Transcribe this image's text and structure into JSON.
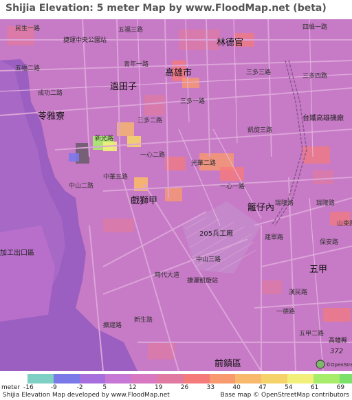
{
  "title": "Shijia Elevation: 5 meter Map by www.FloodMap.net (beta)",
  "map": {
    "places": [
      {
        "id": "lindeguan",
        "name": "林德官"
      },
      {
        "id": "kaohsiung",
        "name": "高雄市"
      },
      {
        "id": "guotianzi",
        "name": "過田子"
      },
      {
        "id": "lingyaliao",
        "name": "苓雅寮"
      },
      {
        "id": "xishijia",
        "name": "戲獅甲"
      },
      {
        "id": "longzainei",
        "name": "籬仔內"
      },
      {
        "id": "wujia",
        "name": "五甲"
      },
      {
        "id": "qianzhen",
        "name": "前鎮區"
      },
      {
        "id": "factory205",
        "name": "205兵工廠"
      },
      {
        "id": "railstation",
        "name": "台鐵高雄機廠"
      },
      {
        "id": "exportzone",
        "name": "加工出口區"
      },
      {
        "id": "mrt_sanduo",
        "name": "捷運中央公園站"
      },
      {
        "id": "mrt_kaisuan",
        "name": "捷運凱旋站"
      }
    ],
    "roads": [
      {
        "id": "minsheng",
        "name": "民生一路"
      },
      {
        "id": "wufu",
        "name": "五福二路"
      },
      {
        "id": "wufu3",
        "name": "五福三路"
      },
      {
        "id": "qingnian",
        "name": "青年一路"
      },
      {
        "id": "sanduo",
        "name": "三多一路"
      },
      {
        "id": "sanduo2",
        "name": "三多二路"
      },
      {
        "id": "sanduo3",
        "name": "三多三路"
      },
      {
        "id": "sanduo4",
        "name": "三多四路"
      },
      {
        "id": "sanduo1b",
        "name": "三多一路"
      },
      {
        "id": "sixin",
        "name": "四維一路"
      },
      {
        "id": "xinguang",
        "name": "新光路"
      },
      {
        "id": "zhonghua",
        "name": "中華五路"
      },
      {
        "id": "zhongshan",
        "name": "中山二路"
      },
      {
        "id": "guanghua",
        "name": "光華二路"
      },
      {
        "id": "xinyi",
        "name": "一心一路"
      },
      {
        "id": "xinyi2",
        "name": "一心二路"
      },
      {
        "id": "kaixuan",
        "name": "凱旋三路"
      },
      {
        "id": "ruilong",
        "name": "瑞隆路"
      },
      {
        "id": "ruilong2",
        "name": "瑞隆路"
      },
      {
        "id": "baoan",
        "name": "保安路"
      },
      {
        "id": "kuanglu",
        "name": "擴建路"
      },
      {
        "id": "shidai",
        "name": "時代大道"
      },
      {
        "id": "yijin",
        "name": "一德路"
      },
      {
        "id": "zhongshan3",
        "name": "中山三路"
      },
      {
        "id": "shandong",
        "name": "山東路"
      },
      {
        "id": "wujia2",
        "name": "五甲二路"
      },
      {
        "id": "xinsheng",
        "name": "新生路"
      },
      {
        "id": "chenggong",
        "name": "成功二路"
      },
      {
        "id": "jianjun",
        "name": "建軍路"
      },
      {
        "id": "hanmin",
        "name": "漢民路"
      }
    ],
    "shield": "372",
    "shield_label": "高雄縣",
    "mapcredit_right": "©OpenStreetMap"
  },
  "legend": {
    "unit_prefix": "meter",
    "ticks": [
      "-16",
      "-9",
      "-2",
      "5",
      "12",
      "19",
      "26",
      "33",
      "40",
      "47",
      "54",
      "61",
      "69"
    ],
    "colors": [
      "#7ecfc4",
      "#7b78e8",
      "#a76fdb",
      "#c778d4",
      "#d878c0",
      "#e07aa0",
      "#f57a7a",
      "#f89a6e",
      "#f8b96c",
      "#f5d36a",
      "#f2f07a",
      "#a8ec6c",
      "#7be06a"
    ]
  },
  "credits": {
    "left": "Shijia Elevation Map developed by www.FloodMap.net",
    "right": "Base map © OpenStreetMap contributors"
  },
  "colors": {
    "land": "#c77ac6",
    "water": "#9a5fc0",
    "road": "#d9a0d6"
  }
}
